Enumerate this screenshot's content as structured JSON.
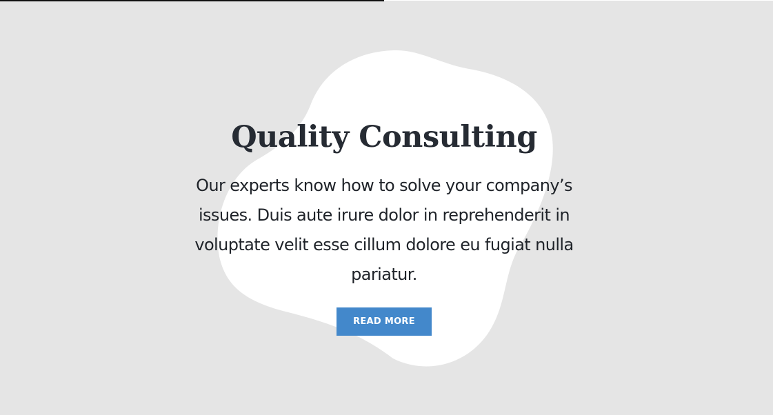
{
  "feature": {
    "title": "Quality Consulting",
    "description": "Our experts know how to solve your company’s issues. Duis aute irure dolor in reprehenderit in voluptate velit esse cillum dolore eu fugiat nulla pariatur.",
    "button_label": "READ MORE"
  },
  "colors": {
    "background": "#e5e5e5",
    "blob": "#ffffff",
    "title": "#262b33",
    "text": "#1f2329",
    "button": "#4388cb",
    "button_text": "#ffffff"
  }
}
